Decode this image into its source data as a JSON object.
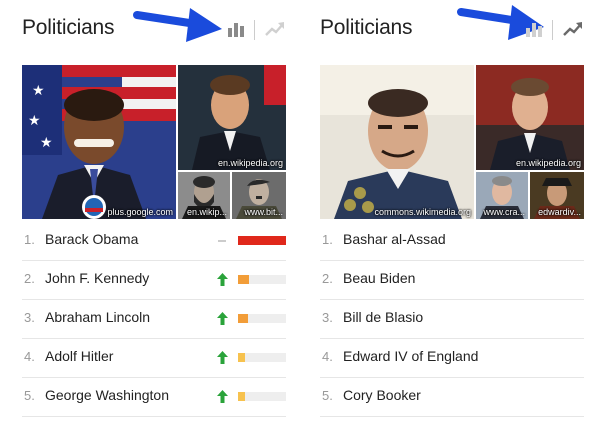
{
  "colors": {
    "arrow_blue": "#1a4bdc",
    "trend_up": "#2aa33a",
    "bar_red": "#e0281b",
    "bar_orange": "#f29d38",
    "bar_yellow": "#f7c24e",
    "icon_grey": "#8a8a8a"
  },
  "left": {
    "title": "Politicians",
    "chart_toggle_bar": "bar-chart-icon",
    "chart_toggle_trend": "trend-line-icon",
    "images": [
      {
        "who": "Barack Obama",
        "caption": "plus.google.com"
      },
      {
        "who": "John F. Kennedy",
        "caption": "en.wikipedia.org"
      },
      {
        "who": "Abraham Lincoln",
        "caption": "en.wikip..."
      },
      {
        "who": "Adolf Hitler",
        "caption": "www.bit..."
      }
    ],
    "rows": [
      {
        "rank": "1.",
        "name": "Barack Obama",
        "trend": "flat",
        "level": 1.0,
        "color": "#e0281b"
      },
      {
        "rank": "2.",
        "name": "John F. Kennedy",
        "trend": "up",
        "level": 0.22,
        "color": "#f29d38"
      },
      {
        "rank": "3.",
        "name": "Abraham Lincoln",
        "trend": "up",
        "level": 0.2,
        "color": "#f29d38"
      },
      {
        "rank": "4.",
        "name": "Adolf Hitler",
        "trend": "up",
        "level": 0.14,
        "color": "#f7c24e"
      },
      {
        "rank": "5.",
        "name": "George Washington",
        "trend": "up",
        "level": 0.14,
        "color": "#f7c24e"
      }
    ]
  },
  "right": {
    "title": "Politicians",
    "chart_toggle_bar": "bar-chart-icon",
    "chart_toggle_trend": "trend-line-icon",
    "images": [
      {
        "who": "Bashar al-Assad",
        "caption": "commons.wikimedia.org"
      },
      {
        "who": "Beau Biden",
        "caption": "en.wikipedia.org"
      },
      {
        "who": "Bill de Blasio",
        "caption": "www.cra..."
      },
      {
        "who": "Edward IV of England",
        "caption": "edwardiv..."
      }
    ],
    "rows": [
      {
        "rank": "1.",
        "name": "Bashar al-Assad"
      },
      {
        "rank": "2.",
        "name": "Beau Biden"
      },
      {
        "rank": "3.",
        "name": "Bill de Blasio"
      },
      {
        "rank": "4.",
        "name": "Edward IV of England"
      },
      {
        "rank": "5.",
        "name": "Cory Booker"
      }
    ]
  }
}
